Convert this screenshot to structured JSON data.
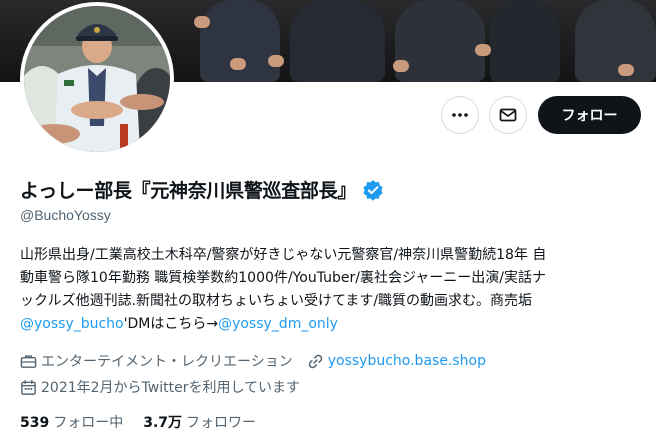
{
  "profile": {
    "display_name": "よっしー部長『元神奈川県警巡査部長』",
    "handle": "@BuchoYossy",
    "verified": true,
    "bio_lines": [
      "山形県出身/工業高校土木科卒/警察が好きじゃない元警察官/神奈川県警勤続18年 自",
      "動車警ら隊10年勤務 職質検挙数約1000件/YouTuber/裏社会ジャーニー出演/実話ナ",
      "ックルズ他週刊誌.新聞社の取材ちょいちょい受けてます/職質の動画求む。商売垢"
    ],
    "bio_mention_1": "@yossy_bucho",
    "bio_mid_text": "'DMはこちら→",
    "bio_mention_2": "@yossy_dm_only",
    "category": "エンターテイメント・レクリエーション",
    "website": "yossybucho.base.shop",
    "joined": "2021年2月からTwitterを利用しています"
  },
  "stats": {
    "following_count": "539",
    "following_label": "フォロー中",
    "followers_count": "3.7万",
    "followers_label": "フォロワー"
  },
  "actions": {
    "follow_label": "フォロー"
  },
  "icons": {
    "more": "more-dots-icon",
    "message": "envelope-icon",
    "verified": "verified-badge-icon",
    "category": "briefcase-icon",
    "website": "link-icon",
    "joined": "calendar-icon"
  },
  "colors": {
    "accent": "#1d9bf0",
    "text_primary": "#0f1419",
    "text_secondary": "#536471",
    "follow_button": "#0f1419"
  }
}
